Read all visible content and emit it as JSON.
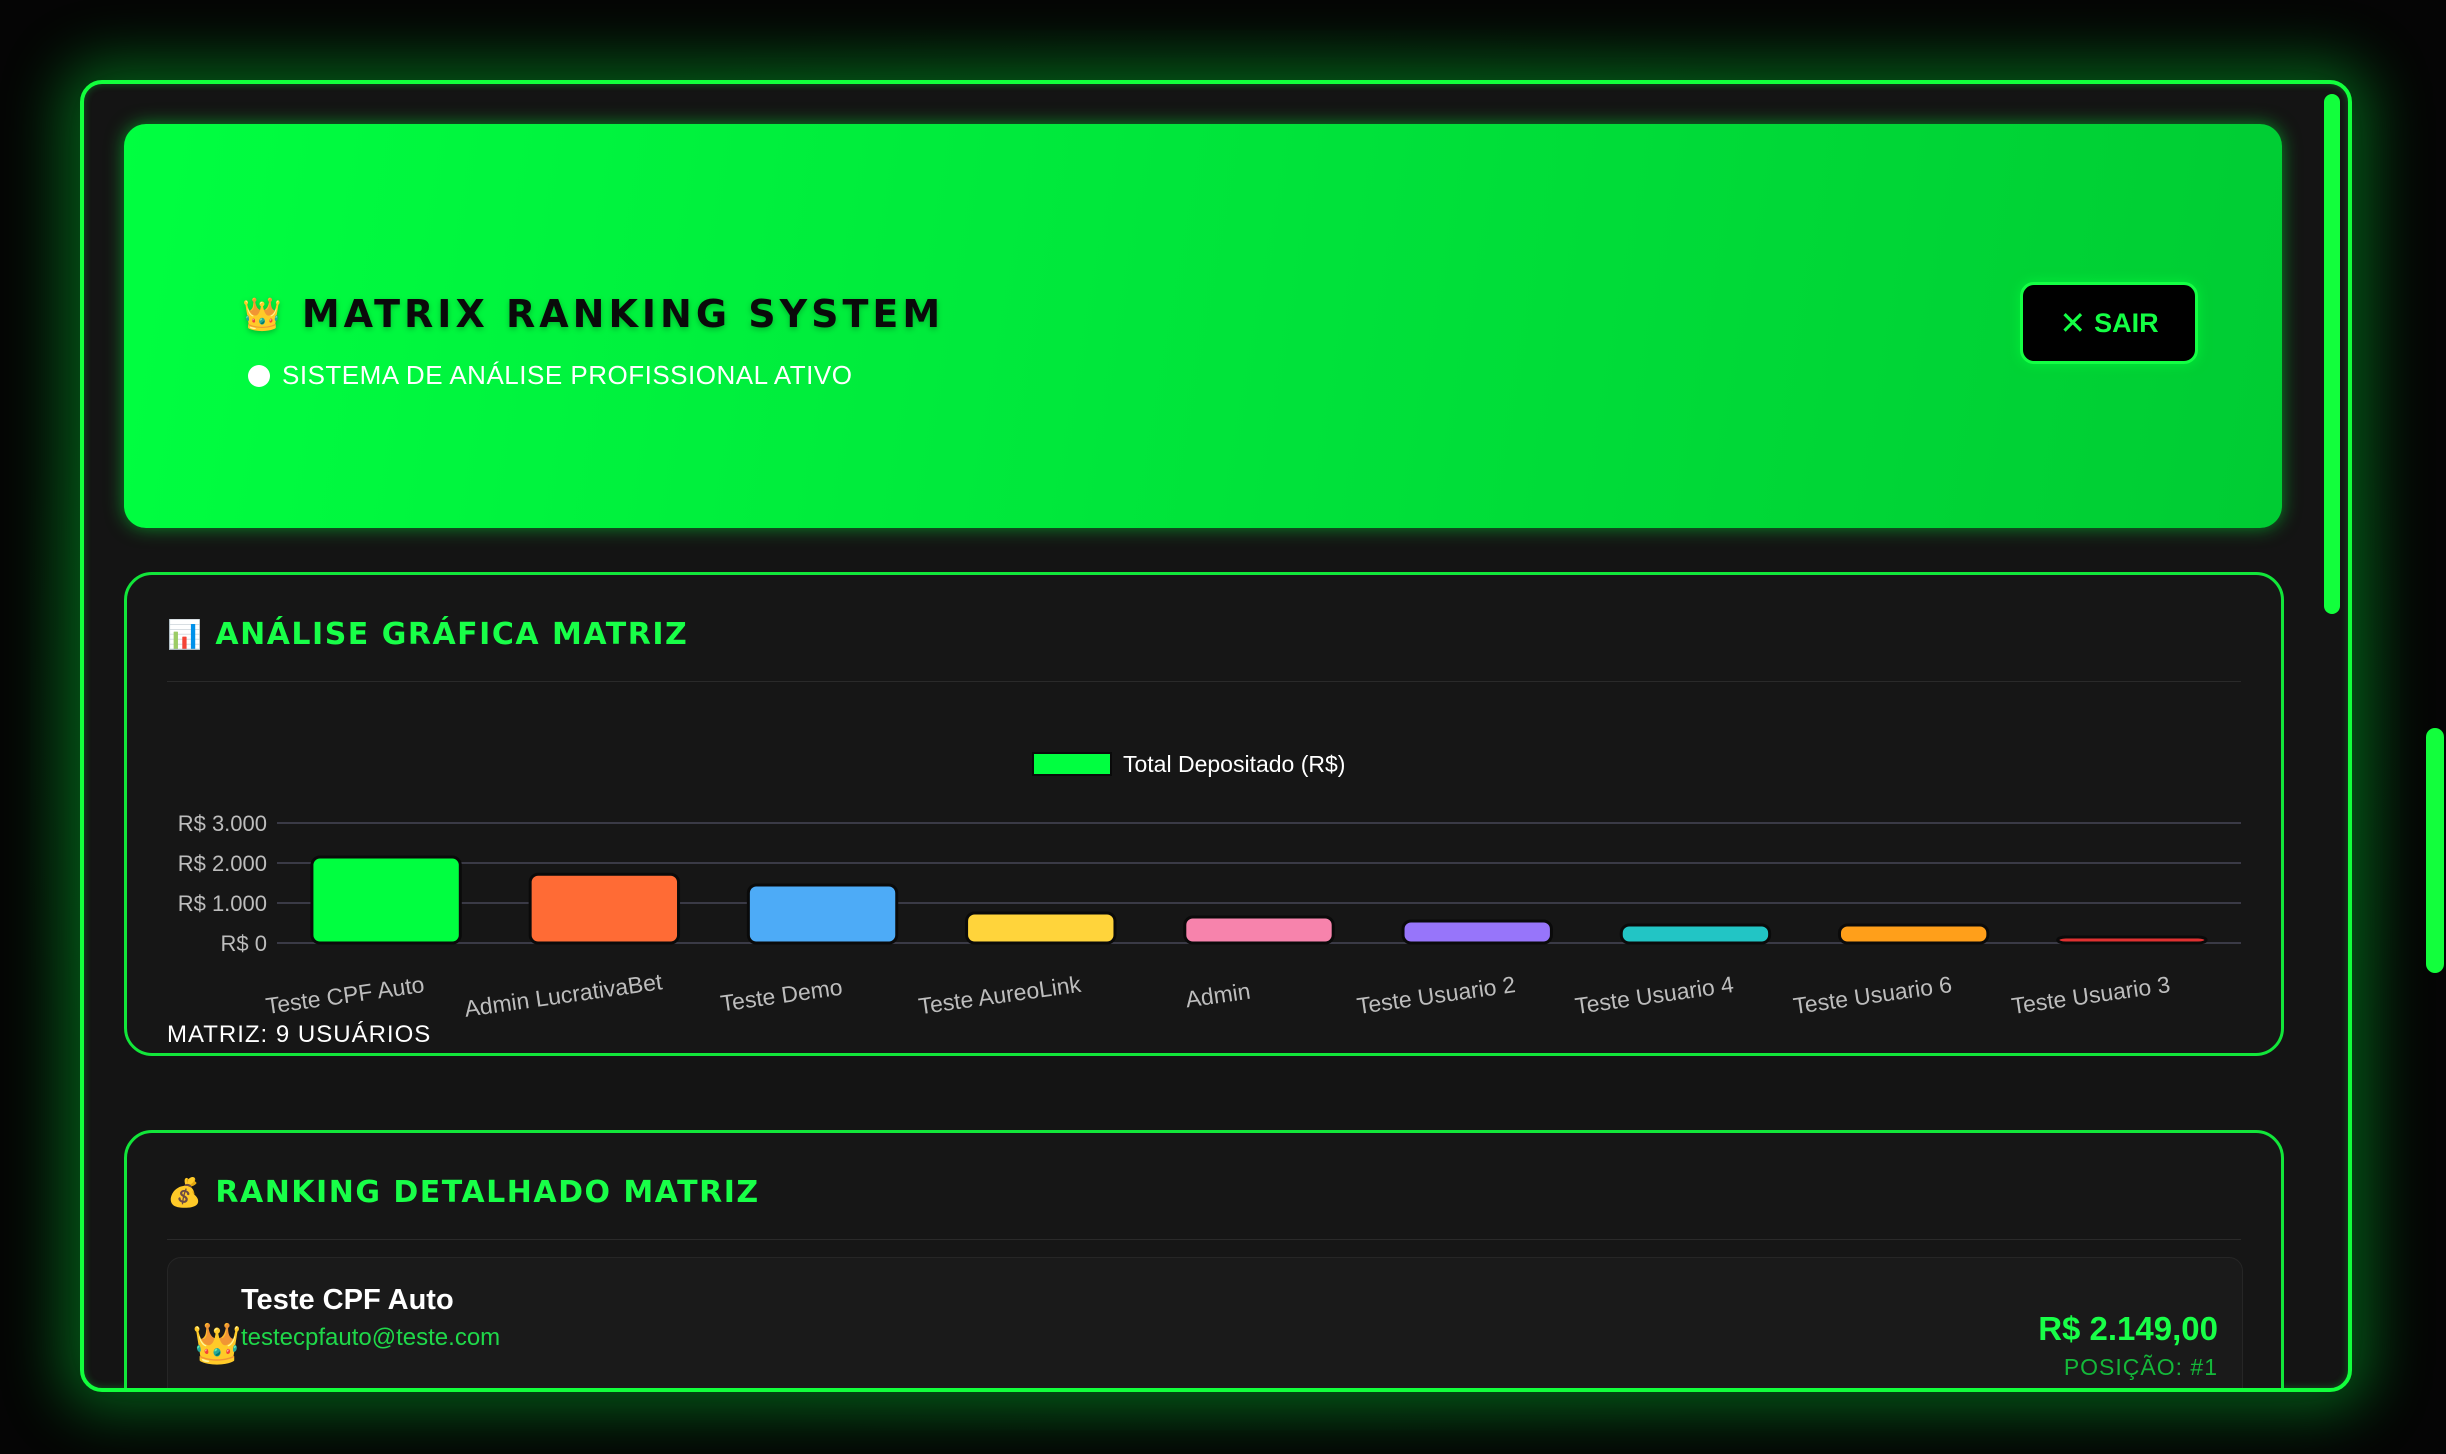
{
  "header": {
    "crown_icon": "👑",
    "title": "MATRIX RANKING SYSTEM",
    "status": "SISTEMA DE ANÁLISE PROFISSIONAL ATIVO",
    "exit_icon": "✕",
    "exit_label": "SAIR"
  },
  "chart_section": {
    "icon": "📊",
    "title": "ANÁLISE GRÁFICA MATRIZ",
    "footer": "MATRIZ: 9 USUÁRIOS"
  },
  "chart_data": {
    "type": "bar",
    "legend": "Total Depositado (R$)",
    "categories": [
      "Teste CPF Auto",
      "Admin LucrativaBet",
      "Teste Demo",
      "Teste AureoLink",
      "Admin",
      "Teste Usuario 2",
      "Teste Usuario 4",
      "Teste Usuario 6",
      "Teste Usuario 3"
    ],
    "values": [
      2149,
      1720,
      1450,
      750,
      650,
      550,
      450,
      450,
      150
    ],
    "colors": [
      "#00ff40",
      "#ff6b35",
      "#4dabf7",
      "#ffd43b",
      "#f783ac",
      "#9775fa",
      "#22c5c5",
      "#ff9f1a",
      "#e03131"
    ],
    "yticks": [
      "R$ 3.000",
      "R$ 2.000",
      "R$ 1.000",
      "R$ 0"
    ],
    "ylim": [
      0,
      3000
    ],
    "grid": true,
    "legend_position": "top-center"
  },
  "ranking_section": {
    "icon": "💰",
    "title": "RANKING DETALHADO MATRIZ",
    "items": [
      {
        "icon": "👑",
        "name": "Teste CPF Auto",
        "email": "testecpfauto@teste.com",
        "value": "R$ 2.149,00",
        "position": "POSIÇÃO: #1"
      }
    ]
  },
  "colors": {
    "accent": "#12ff3c",
    "background": "#141414",
    "card": "#161616"
  }
}
